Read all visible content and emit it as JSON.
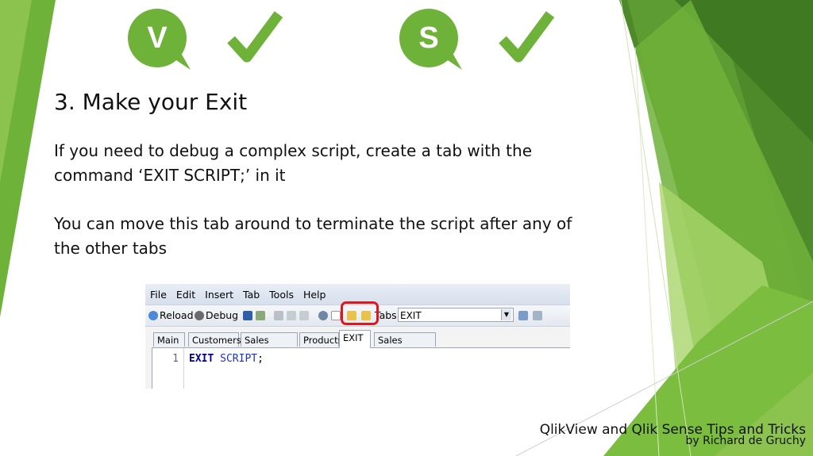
{
  "colors": {
    "green_dark": "#4f8a2a",
    "green_mid": "#6fb23a",
    "green_light": "#a9d46b",
    "highlight_red": "#e0161f"
  },
  "logos": [
    {
      "letter": "V",
      "icon": "qlikview-logo"
    },
    {
      "icon": "check-icon"
    },
    {
      "letter": "S",
      "icon": "qliksense-logo"
    },
    {
      "icon": "check-icon"
    }
  ],
  "slide": {
    "title": "3. Make your Exit",
    "paragraph1_line1": "If you need to debug a complex script, create a tab with the",
    "paragraph1_line2": "command ‘EXIT SCRIPT;’ in it",
    "paragraph2_line1": "You can move this tab around to terminate the script after any of",
    "paragraph2_line2": "the other tabs"
  },
  "editor_window": {
    "menu": [
      "File",
      "Edit",
      "Insert",
      "Tab",
      "Tools",
      "Help"
    ],
    "toolbar": {
      "reload": "Reload",
      "debug": "Debug",
      "tabs_label": "Tabs",
      "tab_select_value": "EXIT"
    },
    "tabs": [
      "Main",
      "Customers",
      "Sales Orders",
      "Products",
      "EXIT",
      "Sales Budgets"
    ],
    "active_tab": "EXIT",
    "code": {
      "line_number": "1",
      "keyword": "EXIT",
      "keyword2": "SCRIPT",
      "terminator": ";"
    }
  },
  "footer": {
    "title": "QlikView and Qlik Sense Tips and Tricks",
    "author": "by Richard de Gruchy"
  }
}
